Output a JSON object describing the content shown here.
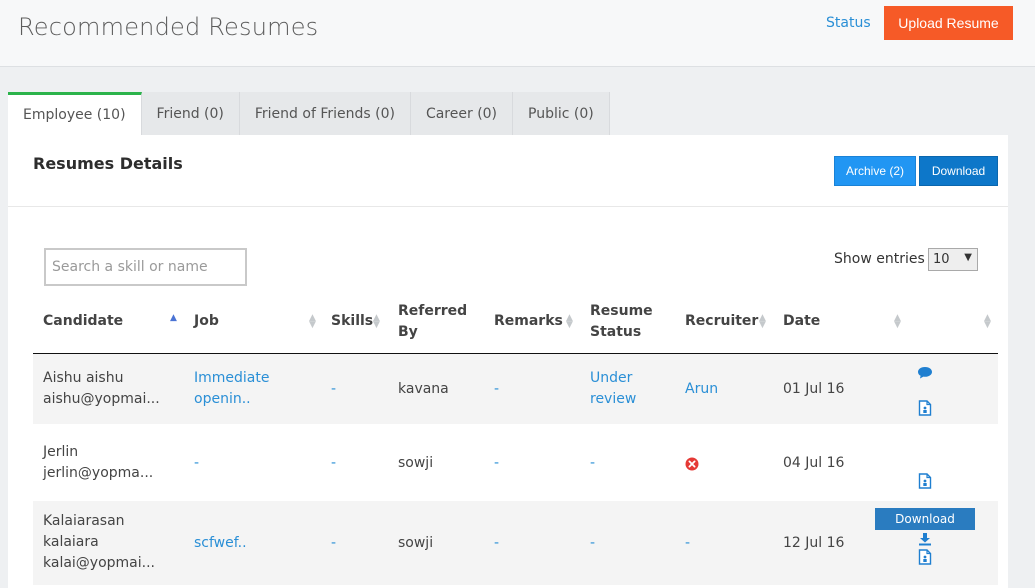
{
  "header": {
    "title": "Recommended Resumes",
    "status_link": "Status",
    "upload_button": "Upload Resume"
  },
  "tabs": [
    {
      "label": "Employee (10)",
      "active": true
    },
    {
      "label": "Friend (0)",
      "active": false
    },
    {
      "label": "Friend of Friends (0)",
      "active": false
    },
    {
      "label": "Career (0)",
      "active": false
    },
    {
      "label": "Public (0)",
      "active": false
    }
  ],
  "panel": {
    "title": "Resumes Details",
    "archive_button": "Archive (2)",
    "download_button": "Download"
  },
  "search": {
    "placeholder": "Search a skill or name",
    "value": ""
  },
  "entries": {
    "label": "Show entries",
    "selected": "10"
  },
  "table": {
    "columns": [
      {
        "line1": "Candidate",
        "line2": "",
        "sort": "asc"
      },
      {
        "line1": "Job",
        "line2": "",
        "sort": "both"
      },
      {
        "line1": "Skills",
        "line2": "",
        "sort": "both"
      },
      {
        "line1": "Referred",
        "line2": "By",
        "sort": "none"
      },
      {
        "line1": "Remarks",
        "line2": "",
        "sort": "both"
      },
      {
        "line1": "Resume",
        "line2": "Status",
        "sort": "none"
      },
      {
        "line1": "Recruiter",
        "line2": "",
        "sort": "both"
      },
      {
        "line1": "Date",
        "line2": "",
        "sort": "both"
      },
      {
        "line1": "",
        "line2": "",
        "sort": "both"
      }
    ],
    "rows": [
      {
        "candidate_lines": [
          "Aishu aishu",
          "aishu@yopmai..."
        ],
        "job_lines": [
          "Immediate",
          "openin.."
        ],
        "skills": "-",
        "referred_by": "kavana",
        "remarks": "-",
        "status_lines": [
          "Under",
          "review"
        ],
        "recruiter": "Arun",
        "date": "01 Jul 16",
        "actions": [
          "comment-icon",
          "resume-file-icon"
        ]
      },
      {
        "candidate_lines": [
          "Jerlin",
          "jerlin@yopma..."
        ],
        "job_lines": [
          "-"
        ],
        "skills": "-",
        "referred_by": "sowji",
        "remarks": "-",
        "status_lines": [
          "-"
        ],
        "recruiter_icon": "red-cross-icon",
        "date": "04 Jul 16",
        "actions": [
          "resume-file-icon"
        ]
      },
      {
        "candidate_lines": [
          "Kalaiarasan",
          "kalaiara",
          "kalai@yopmai..."
        ],
        "job_lines": [
          "scfwef.."
        ],
        "skills": "-",
        "referred_by": "sowji",
        "remarks": "-",
        "status_lines": [
          "-"
        ],
        "recruiter": "-",
        "date": "12 Jul 16",
        "actions": [
          "download-icon",
          "resume-file-icon"
        ]
      }
    ]
  },
  "tooltip": {
    "text": "Download"
  },
  "colors": {
    "accent_orange": "#f65a27",
    "link_blue": "#2a8fd6",
    "tab_active_border": "#2bb34b",
    "button_blue": "#2196f3",
    "button_dark_blue": "#0d77c9",
    "error_red": "#e53935"
  }
}
